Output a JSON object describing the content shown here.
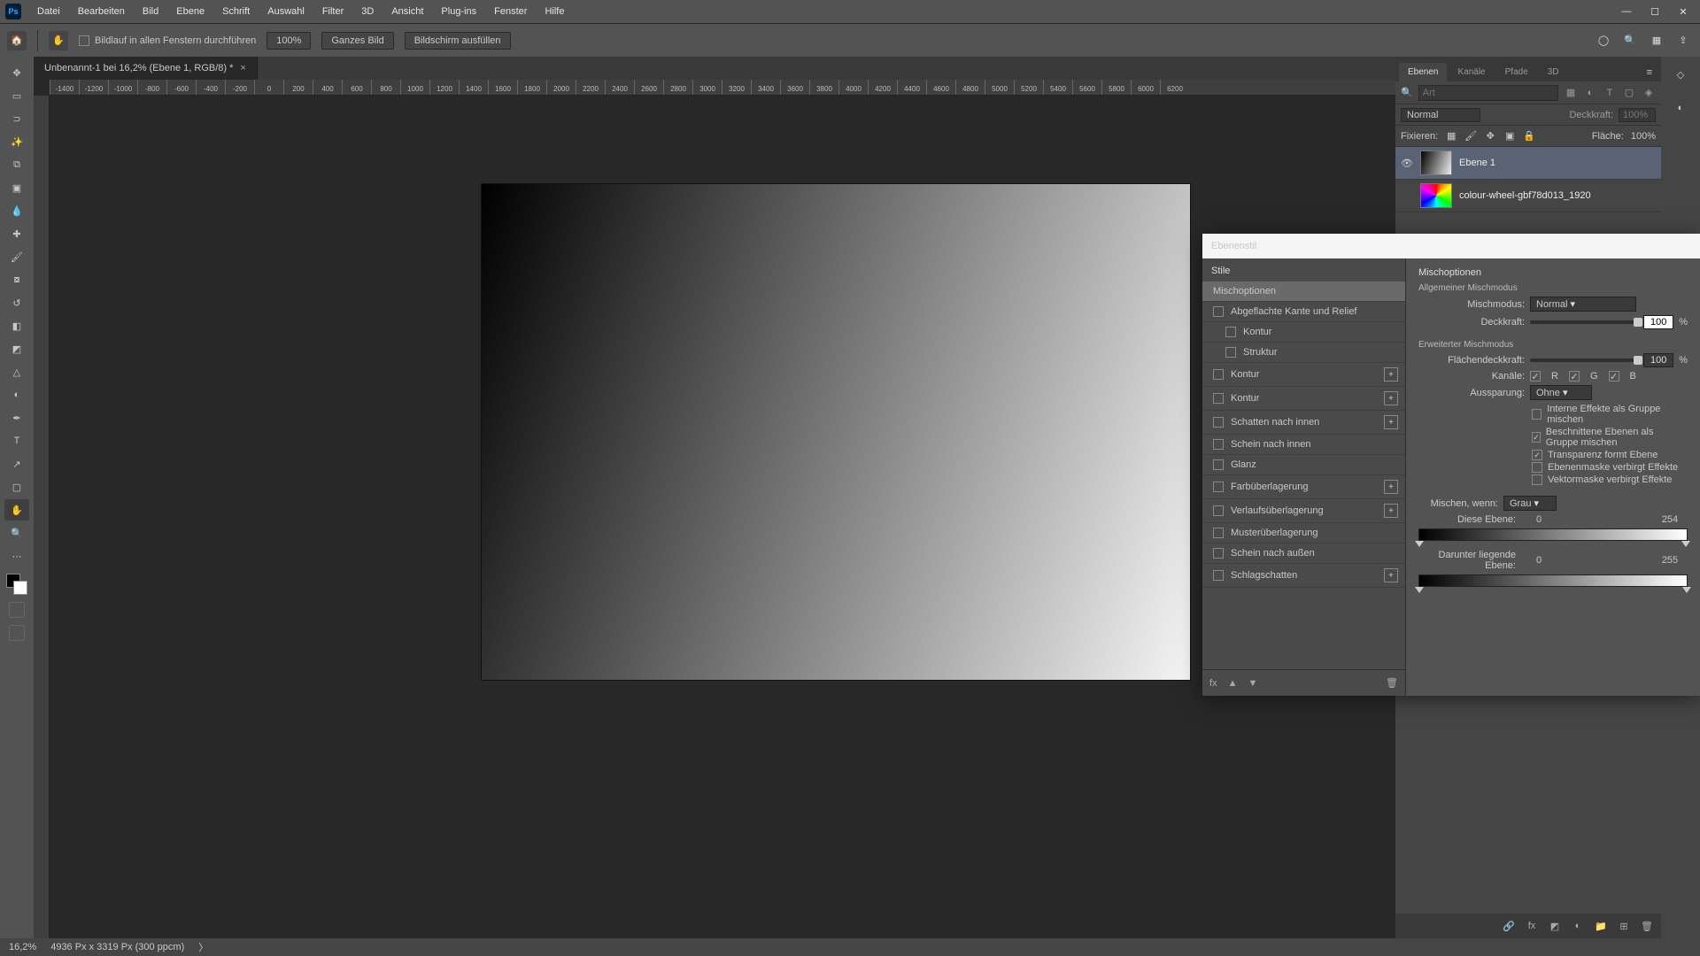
{
  "menubar": {
    "items": [
      "Datei",
      "Bearbeiten",
      "Bild",
      "Ebene",
      "Schrift",
      "Auswahl",
      "Filter",
      "3D",
      "Ansicht",
      "Plug-ins",
      "Fenster",
      "Hilfe"
    ]
  },
  "options": {
    "scrollAll": "Bildlauf in allen Fenstern durchführen",
    "zoom": "100%",
    "fitAll": "Ganzes Bild",
    "fillScreen": "Bildschirm ausfüllen"
  },
  "docTab": {
    "title": "Unbenannt-1 bei 16,2% (Ebene 1, RGB/8) *"
  },
  "ruler": [
    "-1400",
    "-1200",
    "-1000",
    "-800",
    "-600",
    "-400",
    "-200",
    "0",
    "200",
    "400",
    "600",
    "800",
    "1000",
    "1200",
    "1400",
    "1600",
    "1800",
    "2000",
    "2200",
    "2400",
    "2600",
    "2800",
    "3000",
    "3200",
    "3400",
    "3600",
    "3800",
    "4000",
    "4200",
    "4400",
    "4600",
    "4800",
    "5000",
    "5200",
    "5400",
    "5600",
    "5800",
    "6000",
    "6200"
  ],
  "panels": {
    "tabs": [
      "Ebenen",
      "Kanäle",
      "Pfade",
      "3D"
    ],
    "searchPlaceholder": "Art",
    "blendMode": "Normal",
    "opacityLabel": "Deckkraft:",
    "opacityVal": "100%",
    "lockLabel": "Fixieren:",
    "fillLabel": "Fläche:",
    "fillVal": "100%",
    "layers": [
      {
        "name": "Ebene 1",
        "sel": true,
        "thumb": "grad",
        "vis": true
      },
      {
        "name": "colour-wheel-gbf78d013_1920",
        "sel": false,
        "thumb": "wheel",
        "vis": false
      }
    ]
  },
  "status": {
    "zoom": "16,2%",
    "docinfo": "4936 Px x 3319 Px (300 ppcm)"
  },
  "dlg": {
    "title": "Ebenenstil",
    "stylesHeader": "Stile",
    "effects": [
      {
        "label": "Mischoptionen",
        "selected": true,
        "cb": false,
        "plus": false
      },
      {
        "label": "Abgeflachte Kante und Relief",
        "cb": true
      },
      {
        "label": "Kontur",
        "cb": true,
        "sub": true
      },
      {
        "label": "Struktur",
        "cb": true,
        "sub": true
      },
      {
        "label": "Kontur",
        "cb": true,
        "plus": true
      },
      {
        "label": "Kontur",
        "cb": true,
        "plus": true
      },
      {
        "label": "Schatten nach innen",
        "cb": true,
        "plus": true
      },
      {
        "label": "Schein nach innen",
        "cb": true
      },
      {
        "label": "Glanz",
        "cb": true
      },
      {
        "label": "Farbüberlagerung",
        "cb": true,
        "plus": true
      },
      {
        "label": "Verlaufsüberlagerung",
        "cb": true,
        "plus": true
      },
      {
        "label": "Musterüberlagerung",
        "cb": true
      },
      {
        "label": "Schein nach außen",
        "cb": true
      },
      {
        "label": "Schlagschatten",
        "cb": true,
        "plus": true
      }
    ],
    "right": {
      "header": "Mischoptionen",
      "general": "Allgemeiner Mischmodus",
      "modeLabel": "Mischmodus:",
      "mode": "Normal",
      "opacityLabel": "Deckkraft:",
      "opacity": "100",
      "pct": "%",
      "advanced": "Erweiterter Mischmodus",
      "fillLabel": "Flächendeckkraft:",
      "fill": "100",
      "channelsLabel": "Kanäle:",
      "chR": "R",
      "chG": "G",
      "chB": "B",
      "knockoutLabel": "Aussparung:",
      "knockout": "Ohne",
      "chk1": "Interne Effekte als Gruppe mischen",
      "chk2": "Beschnittene Ebenen als Gruppe mischen",
      "chk3": "Transparenz formt Ebene",
      "chk4": "Ebenenmaske verbirgt Effekte",
      "chk5": "Vektormaske verbirgt Effekte",
      "blendIfLabel": "Mischen, wenn:",
      "blendIf": "Grau",
      "thisLayer": "Diese Ebene:",
      "thisLow": "0",
      "thisHigh": "254",
      "underLayer": "Darunter liegende Ebene:",
      "underLow": "0",
      "underHigh": "255"
    }
  }
}
